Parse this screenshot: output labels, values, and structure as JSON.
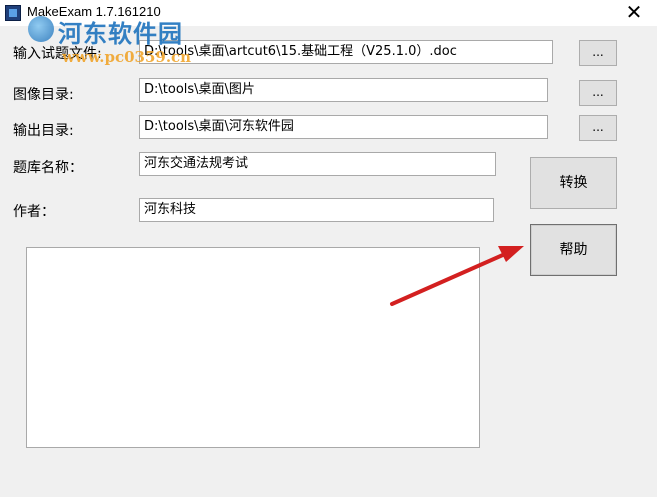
{
  "window": {
    "title": "MakeExam 1.7.161210",
    "close_glyph": "✕"
  },
  "watermark": {
    "site_name": "河东软件园",
    "url": "www.pc0359.cn"
  },
  "form": {
    "input_file": {
      "label": "输入试题文件:",
      "value": "D:\\tools\\桌面\\artcut6\\15.基础工程（V25.1.0）.doc",
      "browse": "..."
    },
    "image_dir": {
      "label": "图像目录:",
      "value": "D:\\tools\\桌面\\图片",
      "browse": "..."
    },
    "output_dir": {
      "label": "输出目录:",
      "value": "D:\\tools\\桌面\\河东软件园",
      "browse": "..."
    },
    "bank_name": {
      "label": "题库名称：",
      "value": "河东交通法规考试"
    },
    "author": {
      "label": "作者：",
      "value": "河东科技"
    }
  },
  "buttons": {
    "convert": "转换",
    "help": "帮助"
  },
  "log": {
    "text": ""
  },
  "colors": {
    "arrow": "#d32020"
  }
}
